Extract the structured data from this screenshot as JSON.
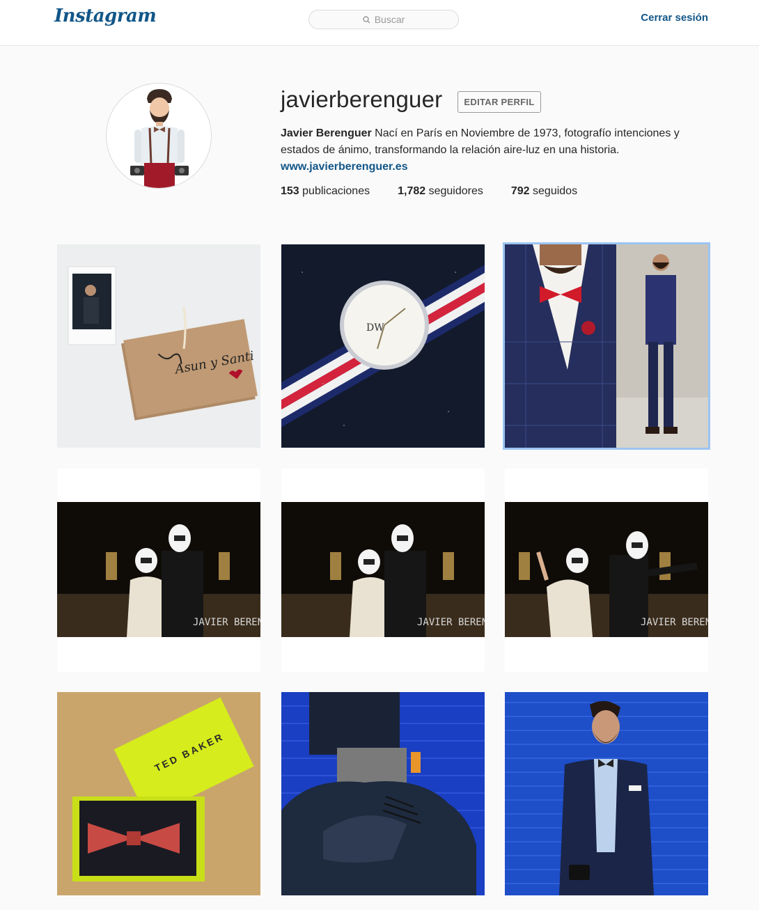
{
  "header": {
    "logo": "Instagram",
    "search_placeholder": "Buscar",
    "logout": "Cerrar sesión"
  },
  "profile": {
    "username": "javierberenguer",
    "edit_button": "EDITAR PERFIL",
    "full_name": "Javier Berenguer",
    "bio": " Nací en París en Noviembre de 1973, fotografío intenciones y estados de ánimo, transformando la relación aire-luz en una historia.",
    "website": "www.javierberenguer.es",
    "stats": {
      "posts_count": "153",
      "posts_label": " publicaciones",
      "followers_count": "1,782",
      "followers_label": " seguidores",
      "following_count": "792",
      "following_label": " seguidos"
    }
  },
  "posts": [
    {
      "name": "wedding-invitation",
      "watermark": "",
      "card_text": "Asun y Santi"
    },
    {
      "name": "wristwatch",
      "watermark": "",
      "card_text": ""
    },
    {
      "name": "navy-suit",
      "watermark": "",
      "card_text": ""
    },
    {
      "name": "stormtrooper-couple-1",
      "watermark": "JAVIER BERENGUER",
      "card_text": ""
    },
    {
      "name": "stormtrooper-couple-2",
      "watermark": "JAVIER BERENGUER",
      "card_text": ""
    },
    {
      "name": "stormtrooper-couple-3",
      "watermark": "JAVIER BERENGUER",
      "card_text": ""
    },
    {
      "name": "ted-baker-bowtie",
      "watermark": "",
      "card_text": "TED BAKER"
    },
    {
      "name": "shoes-blue-shutter",
      "watermark": "",
      "card_text": ""
    },
    {
      "name": "man-blue-shutter",
      "watermark": "",
      "card_text": ""
    }
  ]
}
